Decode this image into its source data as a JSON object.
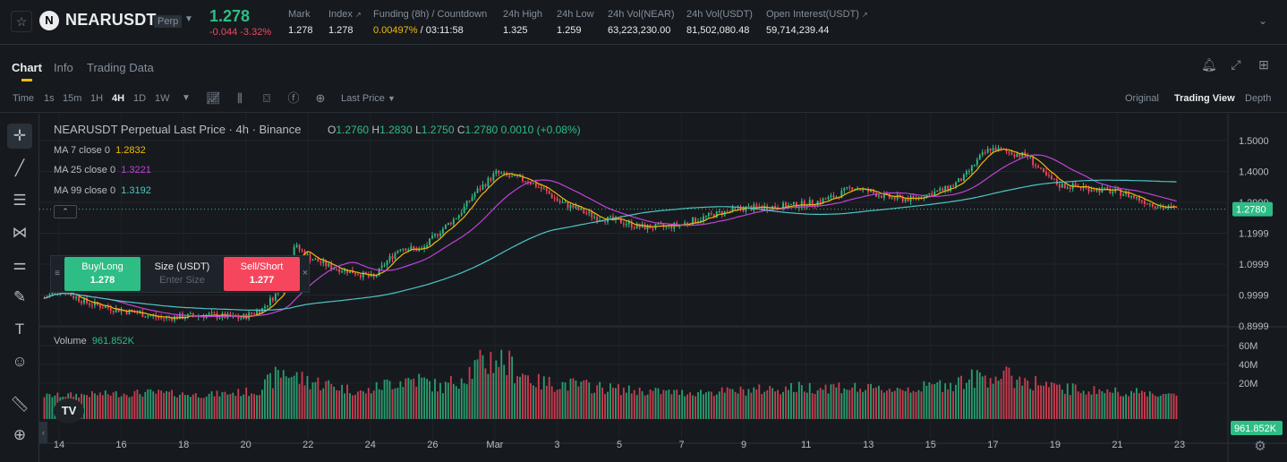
{
  "header": {
    "star_icon": "☆",
    "coin_letter": "N",
    "symbol": "NEARUSDT",
    "badge": "Perp",
    "last_price": "1.278",
    "change": "-0.044 -3.32%",
    "stats": [
      {
        "label": "Mark",
        "value": "1.278",
        "ext": false
      },
      {
        "label": "Index",
        "value": "1.278",
        "ext": true
      },
      {
        "label": "Funding (8h) / Countdown",
        "value_highlight": "0.00497%",
        "value_rest": " / 03:11:58",
        "ext": false
      },
      {
        "label": "24h High",
        "value": "1.325",
        "ext": false
      },
      {
        "label": "24h Low",
        "value": "1.259",
        "ext": false
      },
      {
        "label": "24h Vol(NEAR)",
        "value": "63,223,230.00",
        "ext": false
      },
      {
        "label": "24h Vol(USDT)",
        "value": "81,502,080.48",
        "ext": false
      },
      {
        "label": "Open Interest(USDT)",
        "value": "59,714,239.44",
        "ext": true
      }
    ]
  },
  "tabs": [
    {
      "label": "Chart",
      "active": true
    },
    {
      "label": "Info",
      "active": false
    },
    {
      "label": "Trading Data",
      "active": false
    }
  ],
  "toolbar": {
    "time_label": "Time",
    "intervals": [
      {
        "label": "1s",
        "active": false
      },
      {
        "label": "15m",
        "active": false
      },
      {
        "label": "1H",
        "active": false
      },
      {
        "label": "4H",
        "active": true
      },
      {
        "label": "1D",
        "active": false
      },
      {
        "label": "1W",
        "active": false
      }
    ],
    "price_type": "Last Price",
    "views": [
      {
        "label": "Original",
        "active": false
      },
      {
        "label": "Trading View",
        "active": true
      },
      {
        "label": "Depth",
        "active": false
      }
    ]
  },
  "legend": {
    "title": "NEARUSDT Perpetual Last Price · 4h · Binance",
    "o_label": "O",
    "o": "1.2760",
    "h_label": "H",
    "h": "1.2830",
    "l_label": "L",
    "l": "1.2750",
    "c_label": "C",
    "c": "1.2780",
    "change": "0.0010 (+0.08%)",
    "ma": [
      {
        "label": "MA 7 close 0",
        "value": "1.2832",
        "color": "#f0b90b"
      },
      {
        "label": "MA 25 close 0",
        "value": "1.3221",
        "color": "#c042d6"
      },
      {
        "label": "MA 99 close 0",
        "value": "1.3192",
        "color": "#4fc4c4"
      }
    ],
    "volume_label": "Volume",
    "volume_value": "961.852K"
  },
  "trade_panel": {
    "buy_label": "Buy/Long",
    "buy_price": "1.278",
    "size_label": "Size (USDT)",
    "size_placeholder": "Enter Size",
    "sell_label": "Sell/Short",
    "sell_price": "1.277"
  },
  "colors": {
    "up": "#2ebd85",
    "down": "#f6465d",
    "ma7": "#f0b90b",
    "ma25": "#c042d6",
    "ma99": "#4fc4c4"
  },
  "chart_data": {
    "type": "candlestick",
    "price_axis": [
      "1.5000",
      "1.4000",
      "1.2999",
      "1.1999",
      "1.0999",
      "0.9999",
      "0.8999"
    ],
    "price_range": [
      0.8999,
      1.5
    ],
    "current_price_tag": "1.2780",
    "volume_axis": [
      "60M",
      "40M",
      "20M"
    ],
    "volume_range": [
      0,
      60
    ],
    "current_volume_tag": "961.852K",
    "x_ticks": [
      "14",
      "16",
      "18",
      "20",
      "22",
      "24",
      "26",
      "Mar",
      "3",
      "5",
      "7",
      "9",
      "11",
      "13",
      "15",
      "17",
      "19",
      "21",
      "23"
    ],
    "price_path": [
      [
        0,
        0.99
      ],
      [
        3,
        1.005
      ],
      [
        6,
        1.02
      ],
      [
        10,
        1.0
      ],
      [
        16,
        0.975
      ],
      [
        26,
        0.955
      ],
      [
        36,
        0.94
      ],
      [
        44,
        0.925
      ],
      [
        52,
        0.93
      ],
      [
        62,
        0.935
      ],
      [
        74,
        0.925
      ],
      [
        82,
        0.955
      ],
      [
        90,
        1.03
      ],
      [
        94,
        1.16
      ],
      [
        100,
        1.12
      ],
      [
        108,
        1.09
      ],
      [
        116,
        1.075
      ],
      [
        124,
        1.055
      ],
      [
        128,
        1.1
      ],
      [
        134,
        1.155
      ],
      [
        142,
        1.145
      ],
      [
        148,
        1.2
      ],
      [
        156,
        1.26
      ],
      [
        162,
        1.33
      ],
      [
        170,
        1.395
      ],
      [
        176,
        1.38
      ],
      [
        182,
        1.37
      ],
      [
        188,
        1.34
      ],
      [
        194,
        1.3
      ],
      [
        200,
        1.28
      ],
      [
        208,
        1.25
      ],
      [
        216,
        1.24
      ],
      [
        224,
        1.22
      ],
      [
        234,
        1.22
      ],
      [
        240,
        1.23
      ],
      [
        246,
        1.245
      ],
      [
        254,
        1.265
      ],
      [
        262,
        1.28
      ],
      [
        272,
        1.285
      ],
      [
        282,
        1.29
      ],
      [
        290,
        1.3
      ],
      [
        298,
        1.32
      ],
      [
        304,
        1.35
      ],
      [
        312,
        1.33
      ],
      [
        318,
        1.315
      ],
      [
        326,
        1.31
      ],
      [
        334,
        1.33
      ],
      [
        340,
        1.345
      ],
      [
        346,
        1.38
      ],
      [
        352,
        1.445
      ],
      [
        356,
        1.475
      ],
      [
        364,
        1.46
      ],
      [
        370,
        1.45
      ],
      [
        376,
        1.39
      ],
      [
        382,
        1.355
      ],
      [
        390,
        1.35
      ],
      [
        398,
        1.34
      ],
      [
        406,
        1.33
      ],
      [
        412,
        1.31
      ],
      [
        420,
        1.285
      ],
      [
        426,
        1.28
      ]
    ],
    "volume_profile": [
      [
        0,
        8
      ],
      [
        20,
        10
      ],
      [
        40,
        12
      ],
      [
        60,
        9
      ],
      [
        80,
        14
      ],
      [
        90,
        40
      ],
      [
        96,
        30
      ],
      [
        110,
        20
      ],
      [
        120,
        12
      ],
      [
        130,
        25
      ],
      [
        140,
        30
      ],
      [
        150,
        18
      ],
      [
        160,
        40
      ],
      [
        170,
        58
      ],
      [
        176,
        45
      ],
      [
        186,
        25
      ],
      [
        200,
        22
      ],
      [
        220,
        15
      ],
      [
        240,
        12
      ],
      [
        260,
        14
      ],
      [
        280,
        18
      ],
      [
        300,
        20
      ],
      [
        310,
        16
      ],
      [
        330,
        18
      ],
      [
        350,
        30
      ],
      [
        356,
        35
      ],
      [
        370,
        28
      ],
      [
        380,
        18
      ],
      [
        400,
        14
      ],
      [
        415,
        12
      ],
      [
        426,
        8
      ]
    ],
    "candle_count": 427
  }
}
